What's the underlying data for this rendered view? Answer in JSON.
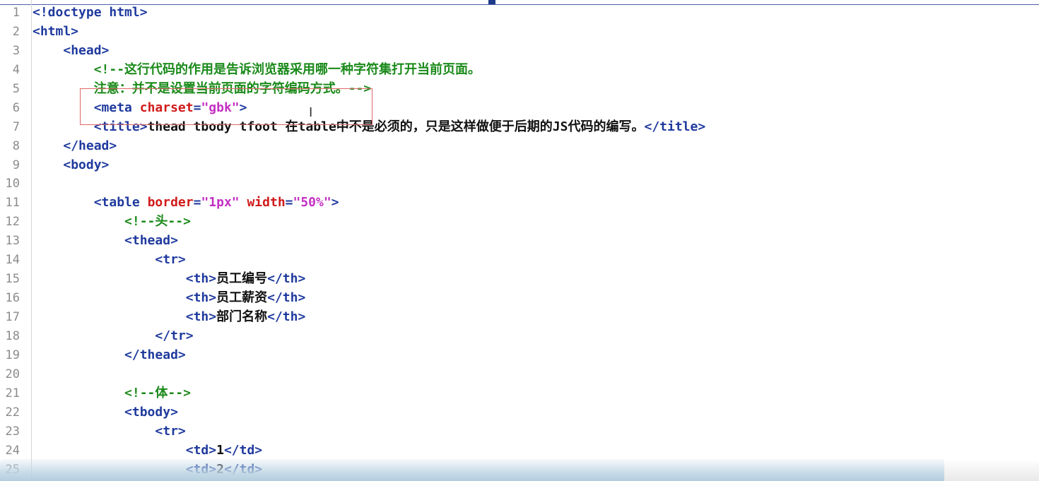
{
  "editor": {
    "lines": [
      {
        "n": "1",
        "indent": "",
        "tokens": [
          [
            "tag",
            "<!doctype html>"
          ]
        ]
      },
      {
        "n": "2",
        "indent": "",
        "tokens": [
          [
            "tag",
            "<html>"
          ]
        ]
      },
      {
        "n": "3",
        "indent": "    ",
        "tokens": [
          [
            "tag",
            "<head>"
          ]
        ]
      },
      {
        "n": "4",
        "indent": "        ",
        "tokens": [
          [
            "cmt",
            "<!--这行代码的作用是告诉浏览器采用哪一种字符集打开当前页面。"
          ]
        ]
      },
      {
        "n": "5",
        "indent": "        ",
        "tokens": [
          [
            "cmt",
            "注意：并不是设置当前页面的字符编码方式。-->"
          ]
        ]
      },
      {
        "n": "6",
        "indent": "        ",
        "tokens": [
          [
            "tag",
            "<meta "
          ],
          [
            "attr",
            "charset"
          ],
          [
            "tag",
            "="
          ],
          [
            "val",
            "\"gbk\""
          ],
          [
            "tag",
            ">"
          ]
        ]
      },
      {
        "n": "7",
        "indent": "        ",
        "tokens": [
          [
            "tag",
            "<title>"
          ],
          [
            "txt",
            "thead tbody tfoot 在table中不是必须的，只是这样做便于后期的JS代码的编写。"
          ],
          [
            "tag",
            "</title>"
          ]
        ]
      },
      {
        "n": "8",
        "indent": "    ",
        "tokens": [
          [
            "tag",
            "</head>"
          ]
        ]
      },
      {
        "n": "9",
        "indent": "    ",
        "tokens": [
          [
            "tag",
            "<body>"
          ]
        ]
      },
      {
        "n": "10",
        "indent": "",
        "tokens": []
      },
      {
        "n": "11",
        "indent": "        ",
        "tokens": [
          [
            "tag",
            "<table "
          ],
          [
            "attr",
            "border"
          ],
          [
            "tag",
            "="
          ],
          [
            "val",
            "\"1px\""
          ],
          [
            "tag",
            " "
          ],
          [
            "attr",
            "width"
          ],
          [
            "tag",
            "="
          ],
          [
            "val",
            "\"50%\""
          ],
          [
            "tag",
            ">"
          ]
        ]
      },
      {
        "n": "12",
        "indent": "            ",
        "tokens": [
          [
            "cmt",
            "<!--头-->"
          ]
        ]
      },
      {
        "n": "13",
        "indent": "            ",
        "tokens": [
          [
            "tag",
            "<thead>"
          ]
        ]
      },
      {
        "n": "14",
        "indent": "                ",
        "tokens": [
          [
            "tag",
            "<tr>"
          ]
        ]
      },
      {
        "n": "15",
        "indent": "                    ",
        "tokens": [
          [
            "tag",
            "<th>"
          ],
          [
            "txt",
            "员工编号"
          ],
          [
            "tag",
            "</th>"
          ]
        ]
      },
      {
        "n": "16",
        "indent": "                    ",
        "tokens": [
          [
            "tag",
            "<th>"
          ],
          [
            "txt",
            "员工薪资"
          ],
          [
            "tag",
            "</th>"
          ]
        ]
      },
      {
        "n": "17",
        "indent": "                    ",
        "tokens": [
          [
            "tag",
            "<th>"
          ],
          [
            "txt",
            "部门名称"
          ],
          [
            "tag",
            "</th>"
          ]
        ]
      },
      {
        "n": "18",
        "indent": "                ",
        "tokens": [
          [
            "tag",
            "</tr>"
          ]
        ]
      },
      {
        "n": "19",
        "indent": "            ",
        "tokens": [
          [
            "tag",
            "</thead>"
          ]
        ]
      },
      {
        "n": "20",
        "indent": "",
        "tokens": []
      },
      {
        "n": "21",
        "indent": "            ",
        "tokens": [
          [
            "cmt",
            "<!--体-->"
          ]
        ]
      },
      {
        "n": "22",
        "indent": "            ",
        "tokens": [
          [
            "tag",
            "<tbody>"
          ]
        ]
      },
      {
        "n": "23",
        "indent": "                ",
        "tokens": [
          [
            "tag",
            "<tr>"
          ]
        ]
      },
      {
        "n": "24",
        "indent": "                    ",
        "tokens": [
          [
            "tag",
            "<td>"
          ],
          [
            "txt",
            "1"
          ],
          [
            "tag",
            "</td>"
          ]
        ]
      },
      {
        "n": "25",
        "indent": "                    ",
        "tokens": [
          [
            "tag",
            "<td>"
          ],
          [
            "txt",
            "2"
          ],
          [
            "tag",
            "</td>"
          ]
        ]
      }
    ]
  },
  "colors": {
    "tag": "#1f3a9e",
    "attr": "#d11a1a",
    "value": "#c42fc4",
    "comment": "#1b8a1b",
    "text": "#111111",
    "line_number": "#8b8b8b",
    "highlight_box": "#e06666"
  },
  "icons": {
    "text_cursor": "text-cursor-icon"
  }
}
